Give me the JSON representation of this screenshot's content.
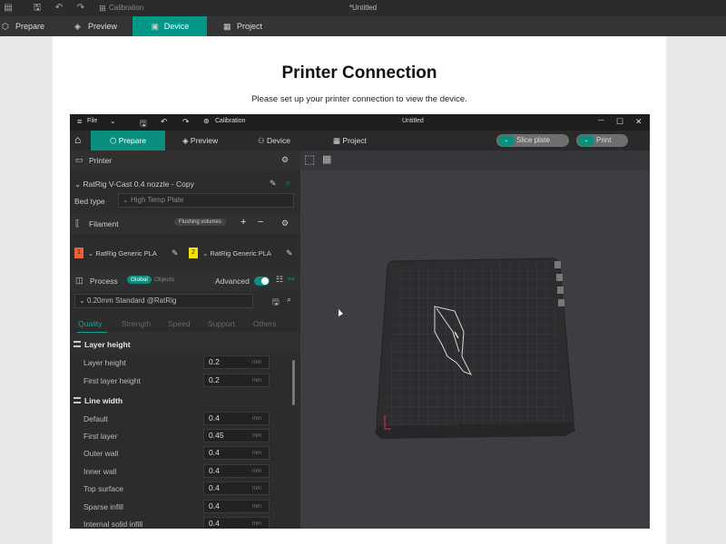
{
  "window": {
    "title": "*Untitled",
    "calibration": "Calibration"
  },
  "tabs": [
    {
      "label": "Prepare"
    },
    {
      "label": "Preview"
    },
    {
      "label": "Device"
    },
    {
      "label": "Project"
    }
  ],
  "page": {
    "heading": "Printer Connection",
    "subtext": "Please set up your printer connection to view the device."
  },
  "inner": {
    "file": "File",
    "calibration": "Calibration",
    "title": "Untitled",
    "tabs": [
      {
        "label": "Prepare"
      },
      {
        "label": "Preview"
      },
      {
        "label": "Device"
      },
      {
        "label": "Project"
      }
    ],
    "slice": "Slice plate",
    "print": "Print",
    "printer": {
      "header": "Printer",
      "name": "RatRig V-Cast 0.4 nozzle - Copy",
      "bed_label": "Bed type",
      "bed_value": "High Temp Plate"
    },
    "filament": {
      "header": "Filament",
      "flushing": "Flushing volumes",
      "items": [
        {
          "num": "1",
          "name": "RatRig Generic PLA",
          "color": "#e8623c"
        },
        {
          "num": "2",
          "name": "RatRig Generic PLA",
          "color": "#f4e400"
        }
      ]
    },
    "process": {
      "header": "Process",
      "global": "Global",
      "objects": "Objects",
      "advanced": "Advanced",
      "profile": "0.20mm Standard @RatRig",
      "subtabs": [
        {
          "label": "Quality"
        },
        {
          "label": "Strength"
        },
        {
          "label": "Speed"
        },
        {
          "label": "Support"
        },
        {
          "label": "Others"
        }
      ],
      "groups": [
        {
          "title": "Layer height"
        },
        {
          "title": "Line width"
        }
      ],
      "params": [
        {
          "label": "Layer height",
          "value": "0.2",
          "unit": "mm"
        },
        {
          "label": "First layer height",
          "value": "0.2",
          "unit": "mm"
        },
        {
          "label": "Default",
          "value": "0.4",
          "unit": "mm"
        },
        {
          "label": "First layer",
          "value": "0.45",
          "unit": "mm"
        },
        {
          "label": "Outer wall",
          "value": "0.4",
          "unit": "mm"
        },
        {
          "label": "Inner wall",
          "value": "0.4",
          "unit": "mm"
        },
        {
          "label": "Top surface",
          "value": "0.4",
          "unit": "mm"
        },
        {
          "label": "Sparse infill",
          "value": "0.4",
          "unit": "mm"
        },
        {
          "label": "Internal solid infill",
          "value": "0.4",
          "unit": "mm"
        }
      ]
    }
  }
}
